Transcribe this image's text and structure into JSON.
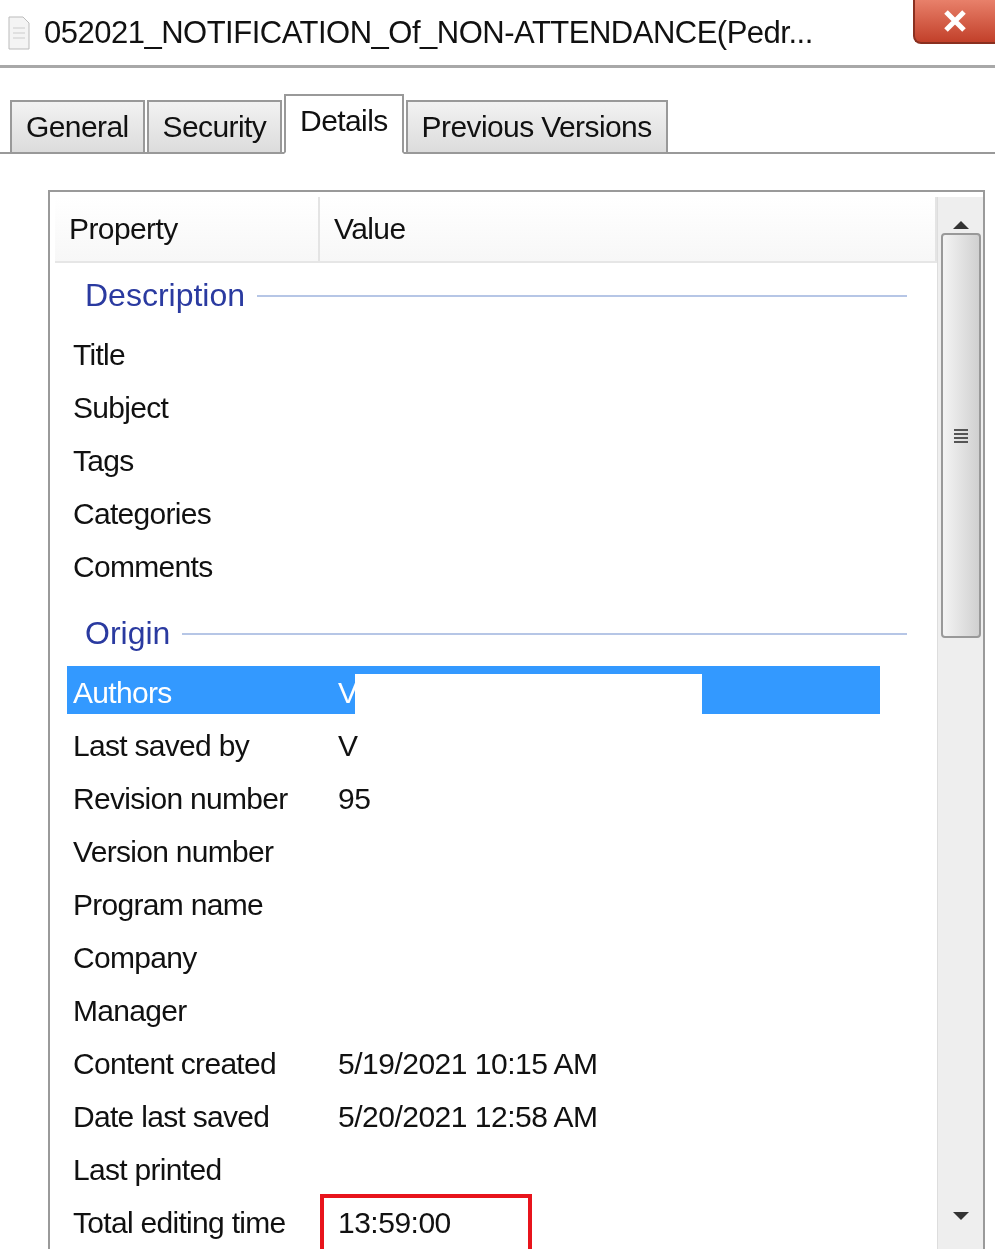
{
  "window": {
    "title": "052021_NOTIFICATION_Of_NON-ATTENDANCE(Pedr..."
  },
  "tabs": [
    {
      "label": "General",
      "selected": false
    },
    {
      "label": "Security",
      "selected": false
    },
    {
      "label": "Details",
      "selected": true
    },
    {
      "label": "Previous Versions",
      "selected": false
    }
  ],
  "list": {
    "columns": [
      "Property",
      "Value"
    ],
    "groups": [
      {
        "title": "Description",
        "rows": [
          {
            "property": "Title",
            "selected": false,
            "redacted": false,
            "boxed": false
          },
          {
            "property": "Subject",
            "selected": false,
            "redacted": false,
            "boxed": false
          },
          {
            "property": "Tags",
            "selected": false,
            "redacted": false,
            "boxed": false
          },
          {
            "property": "Categories",
            "selected": false,
            "redacted": false,
            "boxed": false
          },
          {
            "property": "Comments",
            "selected": false,
            "redacted": false,
            "boxed": false
          }
        ]
      },
      {
        "title": "Origin",
        "rows": [
          {
            "property": "Authors",
            "value": "V",
            "selected": true,
            "redacted": true,
            "boxed": false
          },
          {
            "property": "Last saved by",
            "value": "V",
            "selected": false,
            "redacted": false,
            "boxed": false
          },
          {
            "property": "Revision number",
            "value": "95",
            "selected": false,
            "redacted": false,
            "boxed": false
          },
          {
            "property": "Version number",
            "selected": false,
            "redacted": false,
            "boxed": false
          },
          {
            "property": "Program name",
            "selected": false,
            "redacted": false,
            "boxed": false
          },
          {
            "property": "Company",
            "selected": false,
            "redacted": false,
            "boxed": false
          },
          {
            "property": "Manager",
            "selected": false,
            "redacted": false,
            "boxed": false
          },
          {
            "property": "Content created",
            "value": "5/19/2021 10:15 AM",
            "selected": false,
            "redacted": false,
            "boxed": false
          },
          {
            "property": "Date last saved",
            "value": "5/20/2021 12:58 AM",
            "selected": false,
            "redacted": false,
            "boxed": false
          },
          {
            "property": "Last printed",
            "selected": false,
            "redacted": false,
            "boxed": false
          },
          {
            "property": "Total editing time",
            "value": "13:59:00",
            "selected": false,
            "redacted": false,
            "boxed": true
          }
        ]
      }
    ]
  }
}
